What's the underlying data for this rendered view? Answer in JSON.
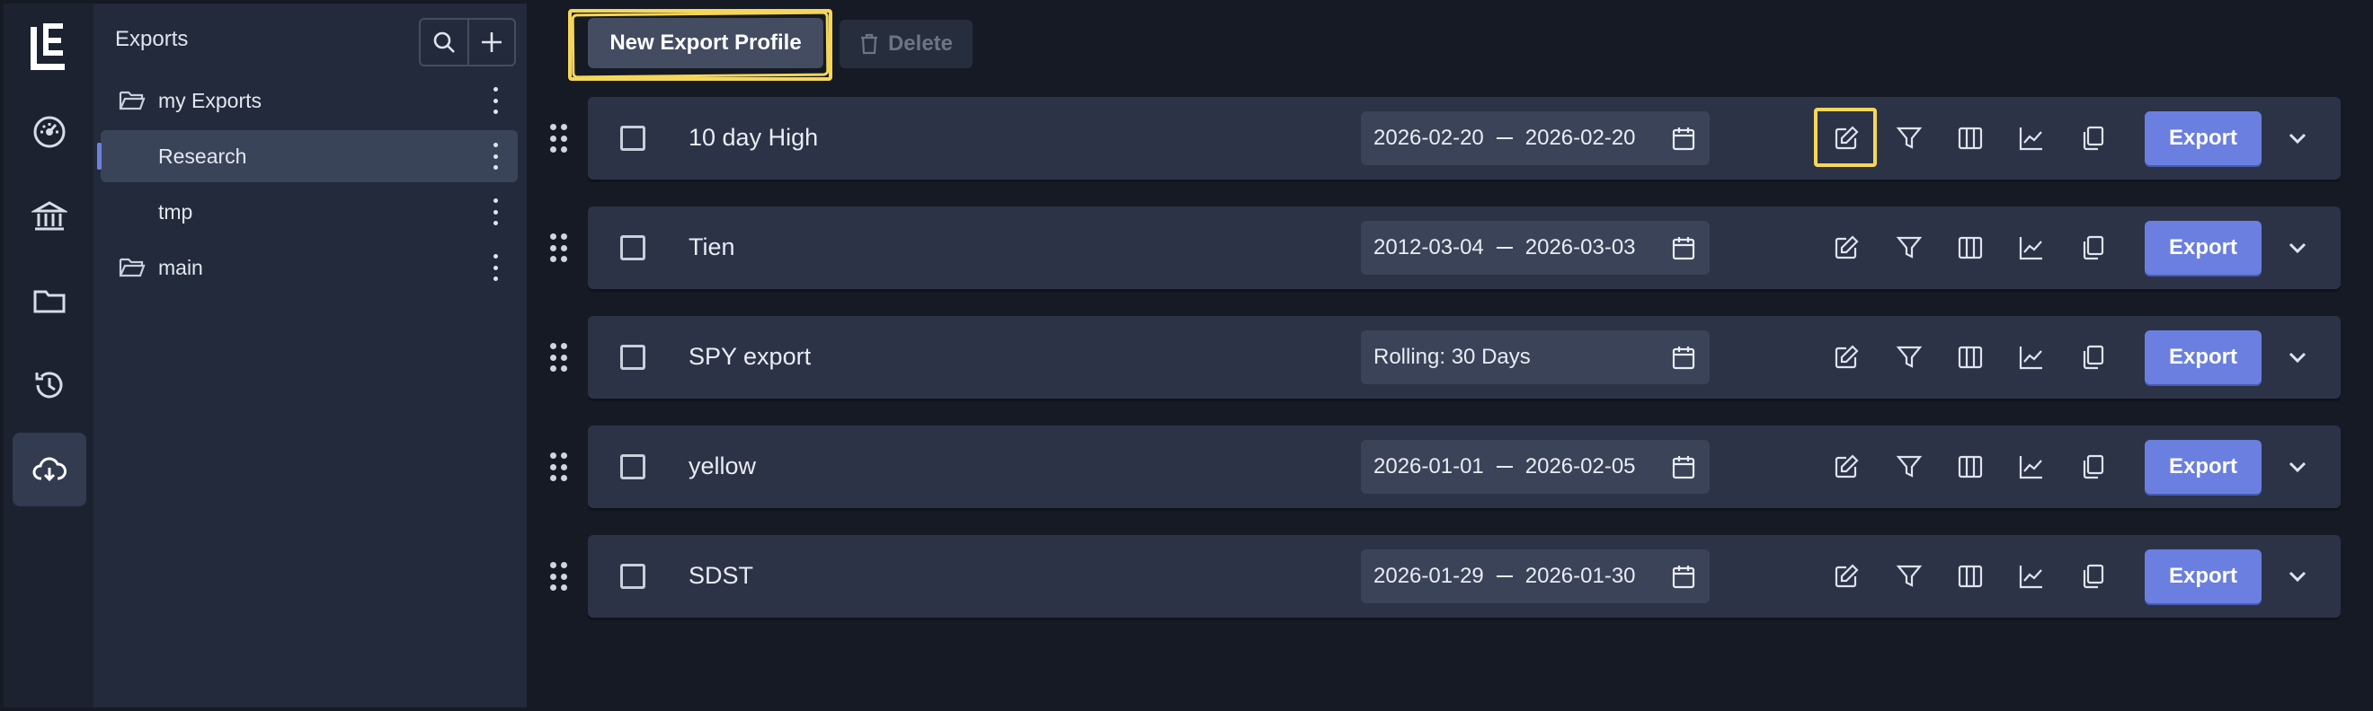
{
  "sidebar_rail": {
    "logo": "exports-logo",
    "items": [
      {
        "icon": "dashboard-gauge-icon",
        "active": false
      },
      {
        "icon": "bank-icon",
        "active": false
      },
      {
        "icon": "folder-icon",
        "active": false
      },
      {
        "icon": "history-icon",
        "active": false
      },
      {
        "icon": "cloud-download-icon",
        "active": true
      }
    ]
  },
  "panel": {
    "title": "Exports",
    "tree": [
      {
        "label": "my Exports",
        "type": "folder"
      },
      {
        "label": "Research",
        "type": "profile-group",
        "active": true
      },
      {
        "label": "tmp",
        "type": "profile-group"
      },
      {
        "label": "main",
        "type": "folder"
      }
    ]
  },
  "toolbar": {
    "new_label": "New Export Profile",
    "delete_label": "Delete"
  },
  "colors": {
    "accent": "#6b7fe0",
    "highlight": "#f6d65a",
    "row_bg": "#2c3347"
  },
  "rows": [
    {
      "name": "10 day High",
      "start": "2026-02-20",
      "end": "2026-02-20",
      "export_label": "Export"
    },
    {
      "name": "Tien",
      "start": "2012-03-04",
      "end": "2026-03-03",
      "export_label": "Export"
    },
    {
      "name": "SPY export",
      "rolling": "Rolling: 30 Days",
      "export_label": "Export"
    },
    {
      "name": "yellow",
      "start": "2026-01-01",
      "end": "2026-02-05",
      "export_label": "Export"
    },
    {
      "name": "SDST",
      "start": "2026-01-29",
      "end": "2026-01-30",
      "export_label": "Export"
    }
  ]
}
